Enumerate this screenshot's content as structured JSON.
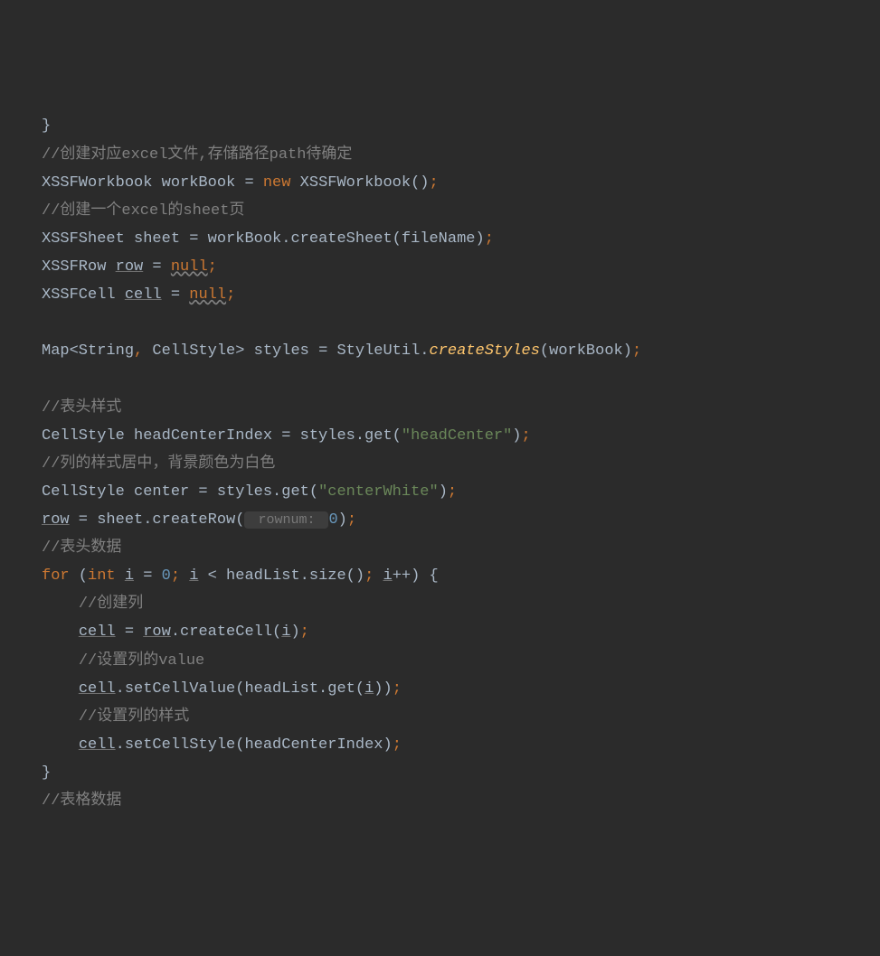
{
  "lines": {
    "l0": "}",
    "l1_comment": "//创建对应excel文件,存储路径path待确定",
    "l2_type": "XSSFWorkbook",
    "l2_var": "workBook",
    "l2_eq": " = ",
    "l2_new": "new",
    "l2_ctor": " XSSFWorkbook()",
    "l2_semi": ";",
    "l3_comment": "//创建一个excel的sheet页",
    "l4_type": "XSSFSheet",
    "l4_var": " sheet = workBook.createSheet(fileName)",
    "l4_semi": ";",
    "l5_type": "XSSFRow ",
    "l5_var": "row",
    "l5_eq": " = ",
    "l5_null": "null",
    "l5_semi": ";",
    "l6_type": "XSSFCell ",
    "l6_var": "cell",
    "l6_eq": " = ",
    "l6_null": "null",
    "l6_semi": ";",
    "l8_a": "Map<String",
    "l8_comma": ",",
    "l8_b": " CellStyle> styles = StyleUtil.",
    "l8_method": "createStyles",
    "l8_c": "(workBook)",
    "l8_semi": ";",
    "l10_comment": "//表头样式",
    "l11_a": "CellStyle headCenterIndex = styles.get(",
    "l11_str": "\"headCenter\"",
    "l11_b": ")",
    "l11_semi": ";",
    "l12_comment": "//列的样式居中，背景颜色为白色",
    "l13_a": "CellStyle center = styles.get(",
    "l13_str": "\"centerWhite\"",
    "l13_b": ")",
    "l13_semi": ";",
    "l14_var": "row",
    "l14_a": " = sheet.createRow(",
    "l14_hint": " rownum: ",
    "l14_num": "0",
    "l14_b": ")",
    "l14_semi": ";",
    "l15_comment": "//表头数据",
    "l16_for": "for",
    "l16_a": " (",
    "l16_int": "int",
    "l16_sp": " ",
    "l16_i1": "i",
    "l16_eq": " = ",
    "l16_num": "0",
    "l16_semi1": ";",
    "l16_sp2": " ",
    "l16_i2": "i",
    "l16_lt": " < headList.size()",
    "l16_semi2": ";",
    "l16_sp3": " ",
    "l16_i3": "i",
    "l16_inc": "++) {",
    "l17_comment": "//创建列",
    "l18_var": "cell",
    "l18_a": " = ",
    "l18_row": "row",
    "l18_b": ".createCell(",
    "l18_i": "i",
    "l18_c": ")",
    "l18_semi": ";",
    "l19_comment": "//设置列的value",
    "l20_var": "cell",
    "l20_a": ".setCellValue(headList.get(",
    "l20_i": "i",
    "l20_b": "))",
    "l20_semi": ";",
    "l21_comment": "//设置列的样式",
    "l22_var": "cell",
    "l22_a": ".setCellStyle(headCenterIndex)",
    "l22_semi": ";",
    "l23": "}",
    "l24_comment": "//表格数据"
  }
}
